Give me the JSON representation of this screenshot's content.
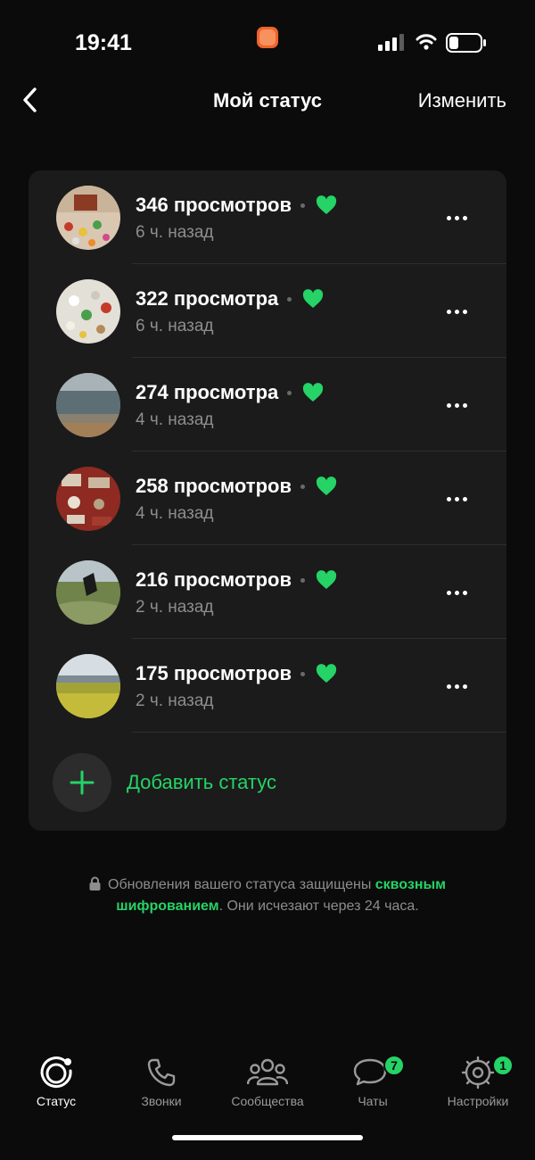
{
  "status_bar": {
    "time": "19:41",
    "app_icon": "momlife-app-icon"
  },
  "header": {
    "back_icon": "chevron-left-icon",
    "title": "Мой статус",
    "edit_label": "Изменить"
  },
  "statuses": [
    {
      "views": "346 просмотров",
      "ago": "6 ч. назад",
      "liked": true
    },
    {
      "views": "322 просмотра",
      "ago": "6 ч. назад",
      "liked": true
    },
    {
      "views": "274 просмотра",
      "ago": "4 ч. назад",
      "liked": true
    },
    {
      "views": "258 просмотров",
      "ago": "4 ч. назад",
      "liked": true
    },
    {
      "views": "216 просмотров",
      "ago": "2 ч. назад",
      "liked": true
    },
    {
      "views": "175 просмотров",
      "ago": "2 ч. назад",
      "liked": true
    }
  ],
  "add_status": {
    "label": "Добавить статус",
    "icon": "plus-icon"
  },
  "info": {
    "text_before": "Обновления вашего статуса защищены ",
    "link_text": "сквозным шифрованием",
    "text_after": ". Они исчезают через 24 часа."
  },
  "tabs": [
    {
      "label": "Статус",
      "icon": "status-ring-icon",
      "active": true,
      "badge": ""
    },
    {
      "label": "Звонки",
      "icon": "phone-icon",
      "active": false,
      "badge": ""
    },
    {
      "label": "Сообщества",
      "icon": "communities-icon",
      "active": false,
      "badge": ""
    },
    {
      "label": "Чаты",
      "icon": "chat-bubbles-icon",
      "active": false,
      "badge": "7"
    },
    {
      "label": "Настройки",
      "icon": "gear-icon",
      "active": false,
      "badge": "1"
    }
  ],
  "colors": {
    "accent": "#25d366",
    "card": "#1b1b1b",
    "background": "#0b0b0b"
  }
}
